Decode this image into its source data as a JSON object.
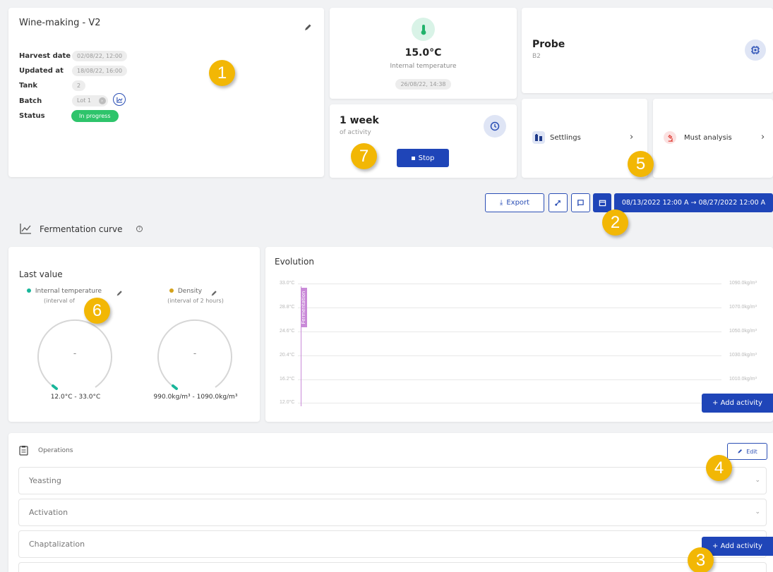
{
  "colors": {
    "accent": "#1f45b8",
    "badge": "#f2b705",
    "status_green": "#2ec46b",
    "teal": "#19b69a",
    "gold": "#d4a21c",
    "fermentation": "#c98ad8"
  },
  "info": {
    "title": "Wine-making - V2",
    "rows": [
      {
        "label": "Harvest date",
        "value": "02/08/22, 12:00"
      },
      {
        "label": "Updated at",
        "value": "18/08/22, 16:00"
      },
      {
        "label": "Tank",
        "value": "2"
      },
      {
        "label": "Batch",
        "value": "Lot 1"
      },
      {
        "label": "Status",
        "value": "In progress"
      }
    ]
  },
  "temperature": {
    "value": "15.0°C",
    "label": "Internal temperature",
    "date": "26/08/22, 14:38"
  },
  "probe": {
    "title": "Probe",
    "subtitle": "B2"
  },
  "activity": {
    "title": "1 week",
    "subtitle": "of activity",
    "stop_label": "Stop"
  },
  "links": {
    "settlings": "Settlings",
    "must": "Must analysis"
  },
  "toolbar": {
    "export": "Export",
    "date_range": "08/13/2022 12:00 A → 08/27/2022 12:00 A"
  },
  "section_title": "Fermentation curve",
  "last_value": {
    "title": "Last value",
    "gauges": [
      {
        "name": "Internal temperature",
        "interval": "(interval of",
        "value": "-",
        "range": "12.0°C - 33.0°C",
        "level": 0
      },
      {
        "name": "Density",
        "interval": "(interval of 2 hours)",
        "value": "-",
        "range": "990.0kg/m³ - 1090.0kg/m³",
        "level": 0
      }
    ]
  },
  "evolution": {
    "title": "Evolution",
    "left_ticks": [
      "33.0°C",
      "28.8°C",
      "24.6°C",
      "20.4°C",
      "16.2°C",
      "12.0°C"
    ],
    "right_ticks": [
      "1090.0kg/m³",
      "1070.0kg/m³",
      "1050.0kg/m³",
      "1030.0kg/m³",
      "1010.0kg/m³"
    ],
    "marker": "Fermentation",
    "add_activity": "+ Add activity"
  },
  "operations": {
    "title": "Operations",
    "edit": "Edit",
    "items": [
      "Yeasting",
      "Activation",
      "Chaptalization"
    ],
    "add_activity": "+ Add activity"
  },
  "badges": [
    "1",
    "2",
    "3",
    "4",
    "5",
    "6",
    "7"
  ]
}
